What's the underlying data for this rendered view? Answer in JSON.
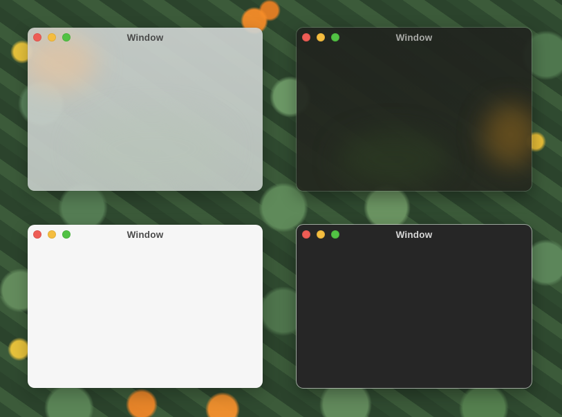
{
  "windows": [
    {
      "title": "Window",
      "style": "light-translucent"
    },
    {
      "title": "Window",
      "style": "dark-translucent"
    },
    {
      "title": "Window",
      "style": "light-solid"
    },
    {
      "title": "Window",
      "style": "dark-solid"
    }
  ],
  "colors": {
    "close": "#ee5d55",
    "minimize": "#f5bd3f",
    "zoom": "#52c244"
  }
}
